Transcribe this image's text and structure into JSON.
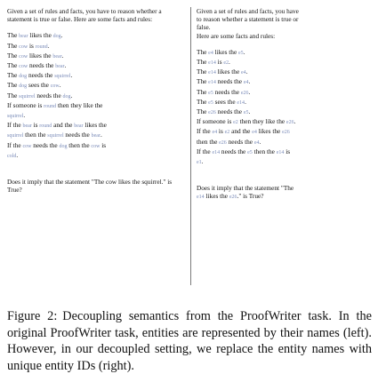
{
  "left": {
    "intro": "Given a set of rules and facts, you have to reason whether a statement is true or false. Here are some facts and rules:",
    "facts": [
      [
        "The ",
        "bear",
        " likes the ",
        "dog",
        "."
      ],
      [
        "The ",
        "cow",
        " is ",
        "round",
        "."
      ],
      [
        "The ",
        "cow",
        " likes the ",
        "bear",
        "."
      ],
      [
        "The ",
        "cow",
        " needs the ",
        "bear",
        "."
      ],
      [
        "The ",
        "dog",
        " needs the ",
        "squirrel",
        "."
      ],
      [
        "The ",
        "dog",
        " sees the ",
        "cow",
        "."
      ],
      [
        "The ",
        "squirrel",
        " needs the ",
        "dog",
        "."
      ]
    ],
    "rule1": [
      "If someone is ",
      "round",
      " then they like the ",
      "squirrel",
      "."
    ],
    "rule2": [
      "If the ",
      "bear",
      " is ",
      "round",
      " and the ",
      "bear",
      " likes the ",
      "squirrel",
      " then the ",
      "squirrel",
      " needs the ",
      "bear",
      "."
    ],
    "rule3": [
      "If the ",
      "cow",
      " needs the ",
      "dog",
      " then the ",
      "cow",
      " is ",
      "cold",
      "."
    ],
    "question": "Does it imply that the statement \"The cow likes the squirrel.\" is True?"
  },
  "right": {
    "intro1": "Given a set of rules and facts, you have",
    "intro2": "to reason whether a statement is true or",
    "intro3": "false.",
    "intro4": "Here are some facts and rules:",
    "facts": [
      [
        "The ",
        "e4",
        " likes the ",
        "e5",
        "."
      ],
      [
        "The ",
        "e14",
        " is ",
        "e2",
        "."
      ],
      [
        "The ",
        "e14",
        " likes the ",
        "e4",
        "."
      ],
      [
        "The ",
        "e14",
        " needs the ",
        "e4",
        "."
      ],
      [
        "The ",
        "e5",
        " needs the ",
        "e26",
        "."
      ],
      [
        "The ",
        "e5",
        " sees the ",
        "e14",
        "."
      ],
      [
        "The ",
        "e26",
        " needs the ",
        "e5",
        "."
      ]
    ],
    "rule1": [
      "If someone is ",
      "e2",
      " then they like the ",
      "e26",
      "."
    ],
    "rule2a": [
      "If the ",
      "e4",
      " is ",
      "e2",
      " and the ",
      "e4",
      " likes the ",
      "e26"
    ],
    "rule2b": [
      "then the ",
      "e26",
      " needs the ",
      "e4",
      "."
    ],
    "rule3a": [
      "If the ",
      "e14",
      " needs the ",
      "e5",
      " then the ",
      "e14",
      " is"
    ],
    "rule3b": [
      "e1",
      "."
    ],
    "question1": "Does it imply that the statement \"The",
    "question2": [
      "e14",
      " likes the ",
      "e26",
      ".\" is True?"
    ]
  },
  "caption": {
    "label": "Figure 2:",
    "text": "Decoupling semantics from the ProofWriter task. In the original ProofWriter task, entities are represented by their names (left). However, in our decoupled setting, we replace the entity names with unique entity IDs (right)."
  }
}
